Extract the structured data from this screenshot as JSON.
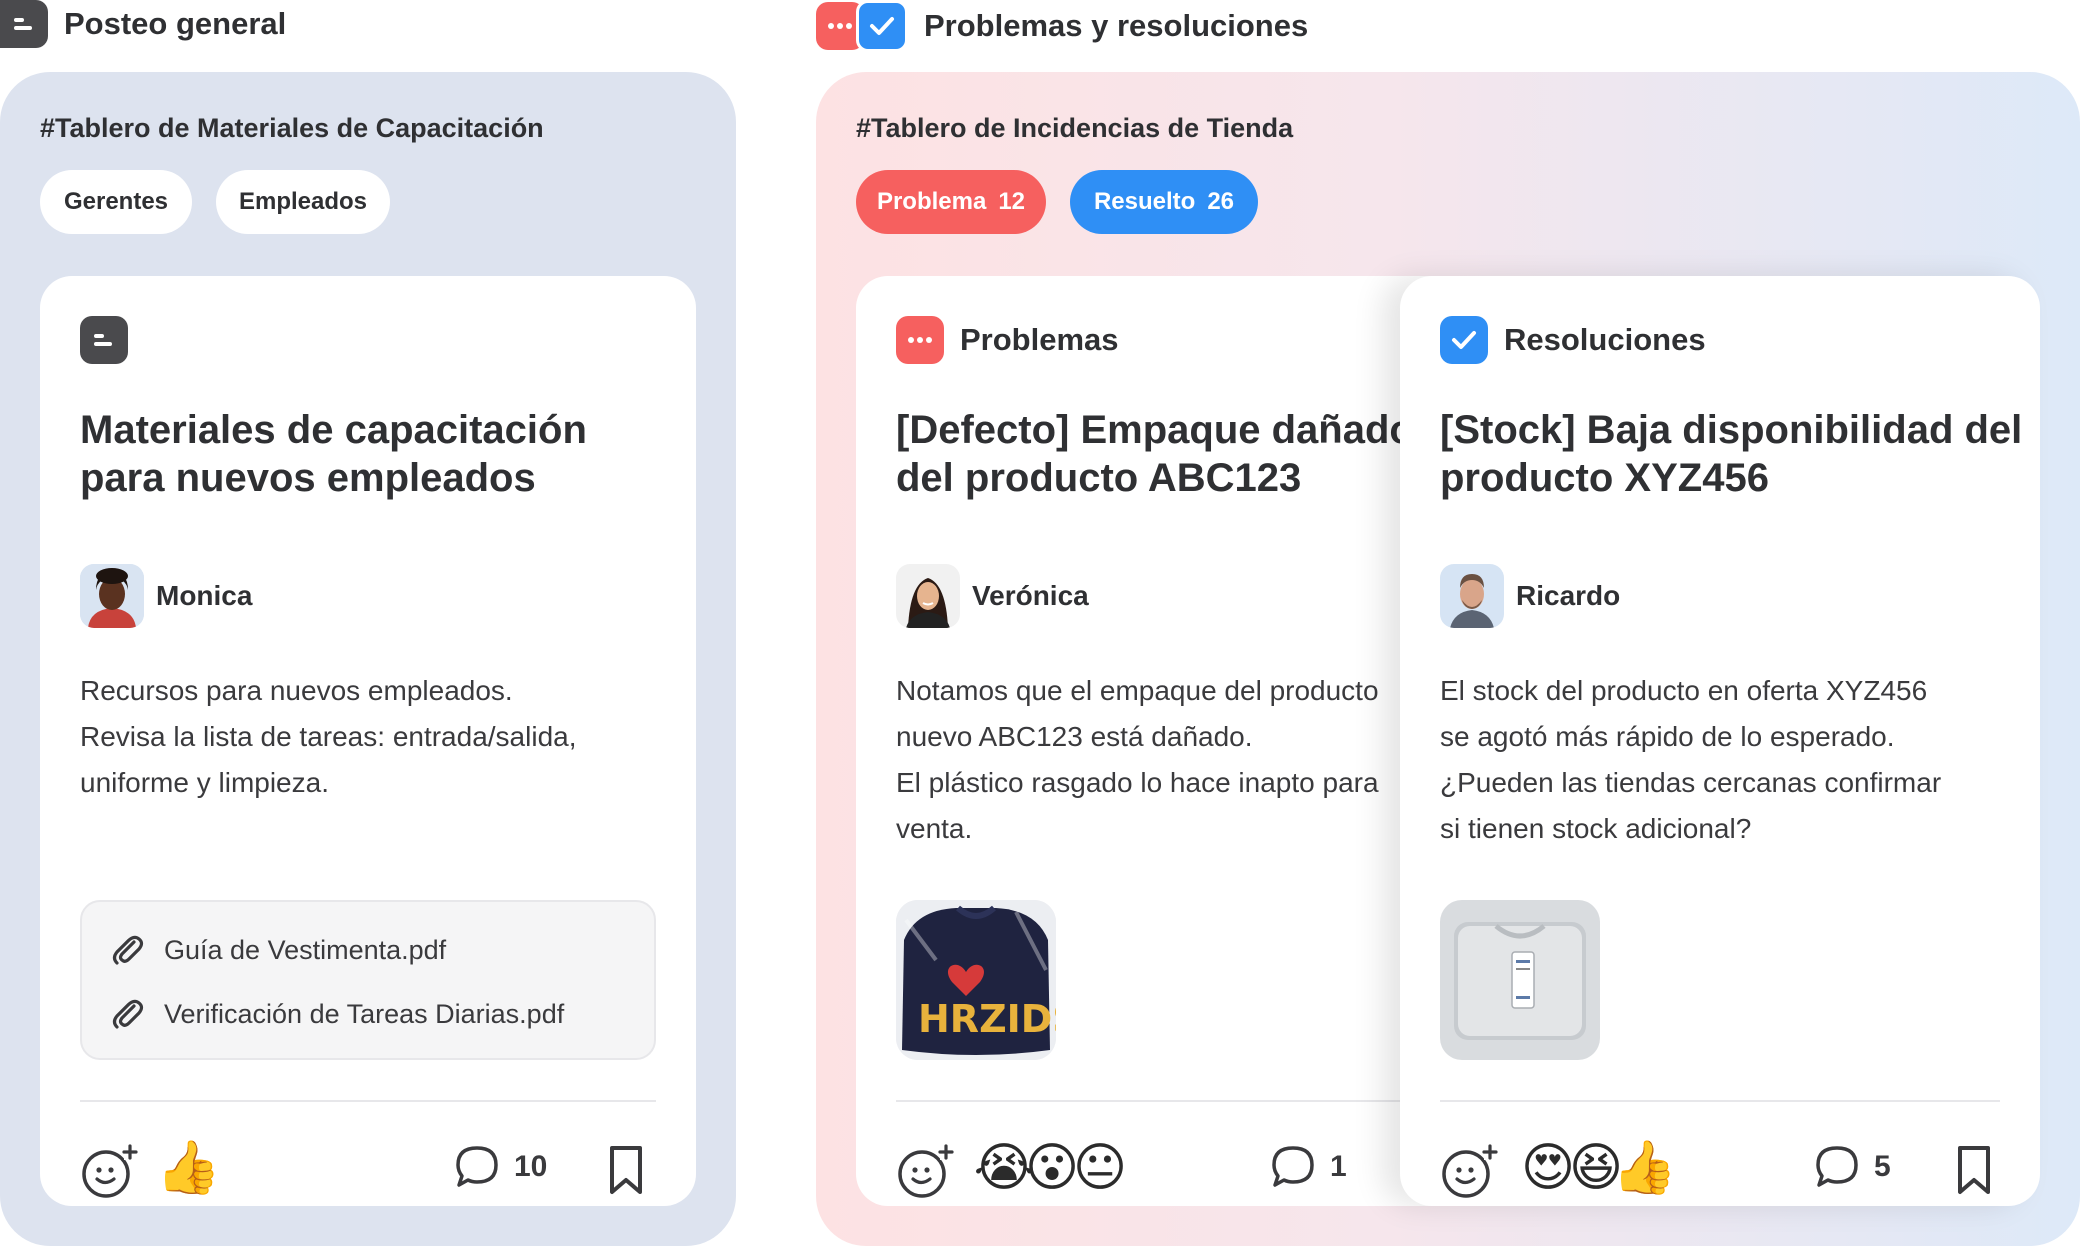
{
  "sections": {
    "general": {
      "title": "Posteo general",
      "icon": "note-icon"
    },
    "issues": {
      "title": "Problemas y resoluciones",
      "icons": [
        "dots-icon",
        "check-icon"
      ]
    }
  },
  "left_board": {
    "title": "#Tablero de Materiales de Capacitación",
    "chips": [
      "Gerentes",
      "Empleados"
    ],
    "card": {
      "icon": "note-icon",
      "title_lines": [
        "Materiales de capacitación",
        "para nuevos empleados"
      ],
      "author": "Monica",
      "body_lines": [
        "Recursos para nuevos empleados.",
        "Revisa la lista de tareas: entrada/salida,",
        "uniforme y limpieza."
      ],
      "attachments": [
        "Guía de Vestimenta.pdf",
        "Verificación de Tareas Diarias.pdf"
      ],
      "reactions": [
        "👍"
      ],
      "comment_count": "10"
    }
  },
  "right_board": {
    "title": "#Tablero de Incidencias de Tienda",
    "chips": [
      {
        "label": "Problema",
        "count": "12",
        "color": "#f6605f"
      },
      {
        "label": "Resuelto",
        "count": "26",
        "color": "#2f8ff5"
      }
    ],
    "problems_card": {
      "header": "Problemas",
      "title_lines": [
        "[Defecto] Empaque dañado",
        "del producto ABC123"
      ],
      "author": "Verónica",
      "body_lines": [
        "Notamos que el empaque del producto",
        "nuevo ABC123 está dañado.",
        "El plástico rasgado lo hace inapto para",
        "venta."
      ],
      "reactions": [
        "😭",
        "😮",
        "😐"
      ],
      "comment_count": "1"
    },
    "resolutions_card": {
      "header": "Resoluciones",
      "title_lines": [
        "[Stock] Baja disponibilidad del",
        "producto XYZ456"
      ],
      "author": "Ricardo",
      "body_lines": [
        "El stock del producto en oferta XYZ456",
        "se agotó más rápido de lo esperado.",
        "¿Pueden las tiendas cercanas confirmar",
        "si tienen stock adicional?"
      ],
      "reactions": [
        "😍",
        "😆",
        "👍"
      ],
      "comment_count": "5"
    }
  },
  "colors": {
    "red": "#f6605f",
    "blue": "#2f8ff5",
    "dark": "#4a4a4d"
  }
}
